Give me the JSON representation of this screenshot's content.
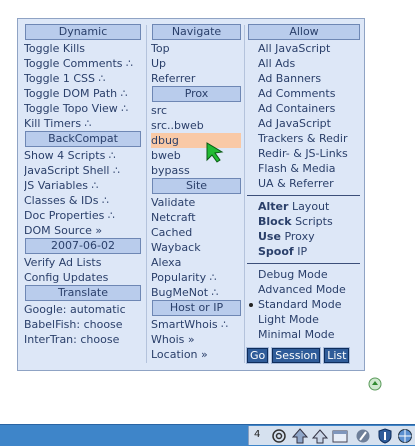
{
  "dynamic": {
    "header": "Dynamic",
    "items": [
      "Toggle Kills",
      "Toggle Comments ∴",
      "Toggle 1 CSS ∴",
      "Toggle DOM Path ∴",
      "Toggle Topo View ∴",
      "Kill Timers ∴"
    ]
  },
  "backcompat": {
    "header": "BackCompat",
    "items": [
      "Show 4 Scripts ∴",
      "JavaScript Shell ∴",
      "JS Variables ∴",
      "Classes & IDs ∴",
      "Doc Properties ∴",
      "DOM Source »"
    ]
  },
  "date": {
    "header": "2007-06-02",
    "items": [
      "Verify Ad Lists",
      "Config Updates"
    ]
  },
  "translate": {
    "header": "Translate",
    "items": [
      "Google: automatic",
      "BabelFish: choose",
      "InterTran: choose"
    ]
  },
  "navigate": {
    "header": "Navigate",
    "items": [
      "Top",
      "Up",
      "Referrer"
    ]
  },
  "prox": {
    "header": "Prox",
    "items": [
      "src",
      "src..bweb",
      "dbug",
      "bweb",
      "bypass"
    ],
    "highlighted": "dbug"
  },
  "site": {
    "header": "Site",
    "items": [
      "Validate",
      "Netcraft",
      "Cached",
      "Wayback",
      "Alexa",
      "Popularity ∴",
      "BugMeNot ∴"
    ]
  },
  "host": {
    "header": "Host or IP",
    "items": [
      "SmartWhois ∴",
      "Whois »",
      "Location »"
    ]
  },
  "allow": {
    "header": "Allow",
    "items": [
      "All JavaScript",
      "All Ads",
      "Ad Banners",
      "Ad Comments",
      "Ad Containers",
      "Ad JavaScript",
      "Trackers & Redir",
      "Redir- & JS-Links",
      "Flash & Media",
      "UA & Referrer"
    ],
    "actions": [
      {
        "bold": "Alter",
        "rest": "Layout"
      },
      {
        "bold": "Block",
        "rest": "Scripts"
      },
      {
        "bold": "Use",
        "rest": "Proxy"
      },
      {
        "bold": "Spoof",
        "rest": "IP"
      }
    ],
    "modes": [
      "Debug Mode",
      "Advanced Mode",
      "Standard Mode",
      "Light Mode",
      "Minimal Mode"
    ],
    "selected_mode": "Standard Mode",
    "buttons": {
      "go": "Go",
      "session": "Session",
      "list": "List"
    }
  },
  "taskbar": {
    "count": "4",
    "icons": [
      "at-icon",
      "upload-icon",
      "up-arrow-icon",
      "window-icon",
      "block-icon",
      "shield-icon",
      "globe-icon"
    ]
  },
  "colors": {
    "panel_bg": "#dde7f7",
    "header_bg": "#b9ccec",
    "highlight": "#f9c9a6",
    "button_bg": "#2f5c99",
    "taskbar_bg": "#3e85c9",
    "cursor": "#22bb33"
  }
}
